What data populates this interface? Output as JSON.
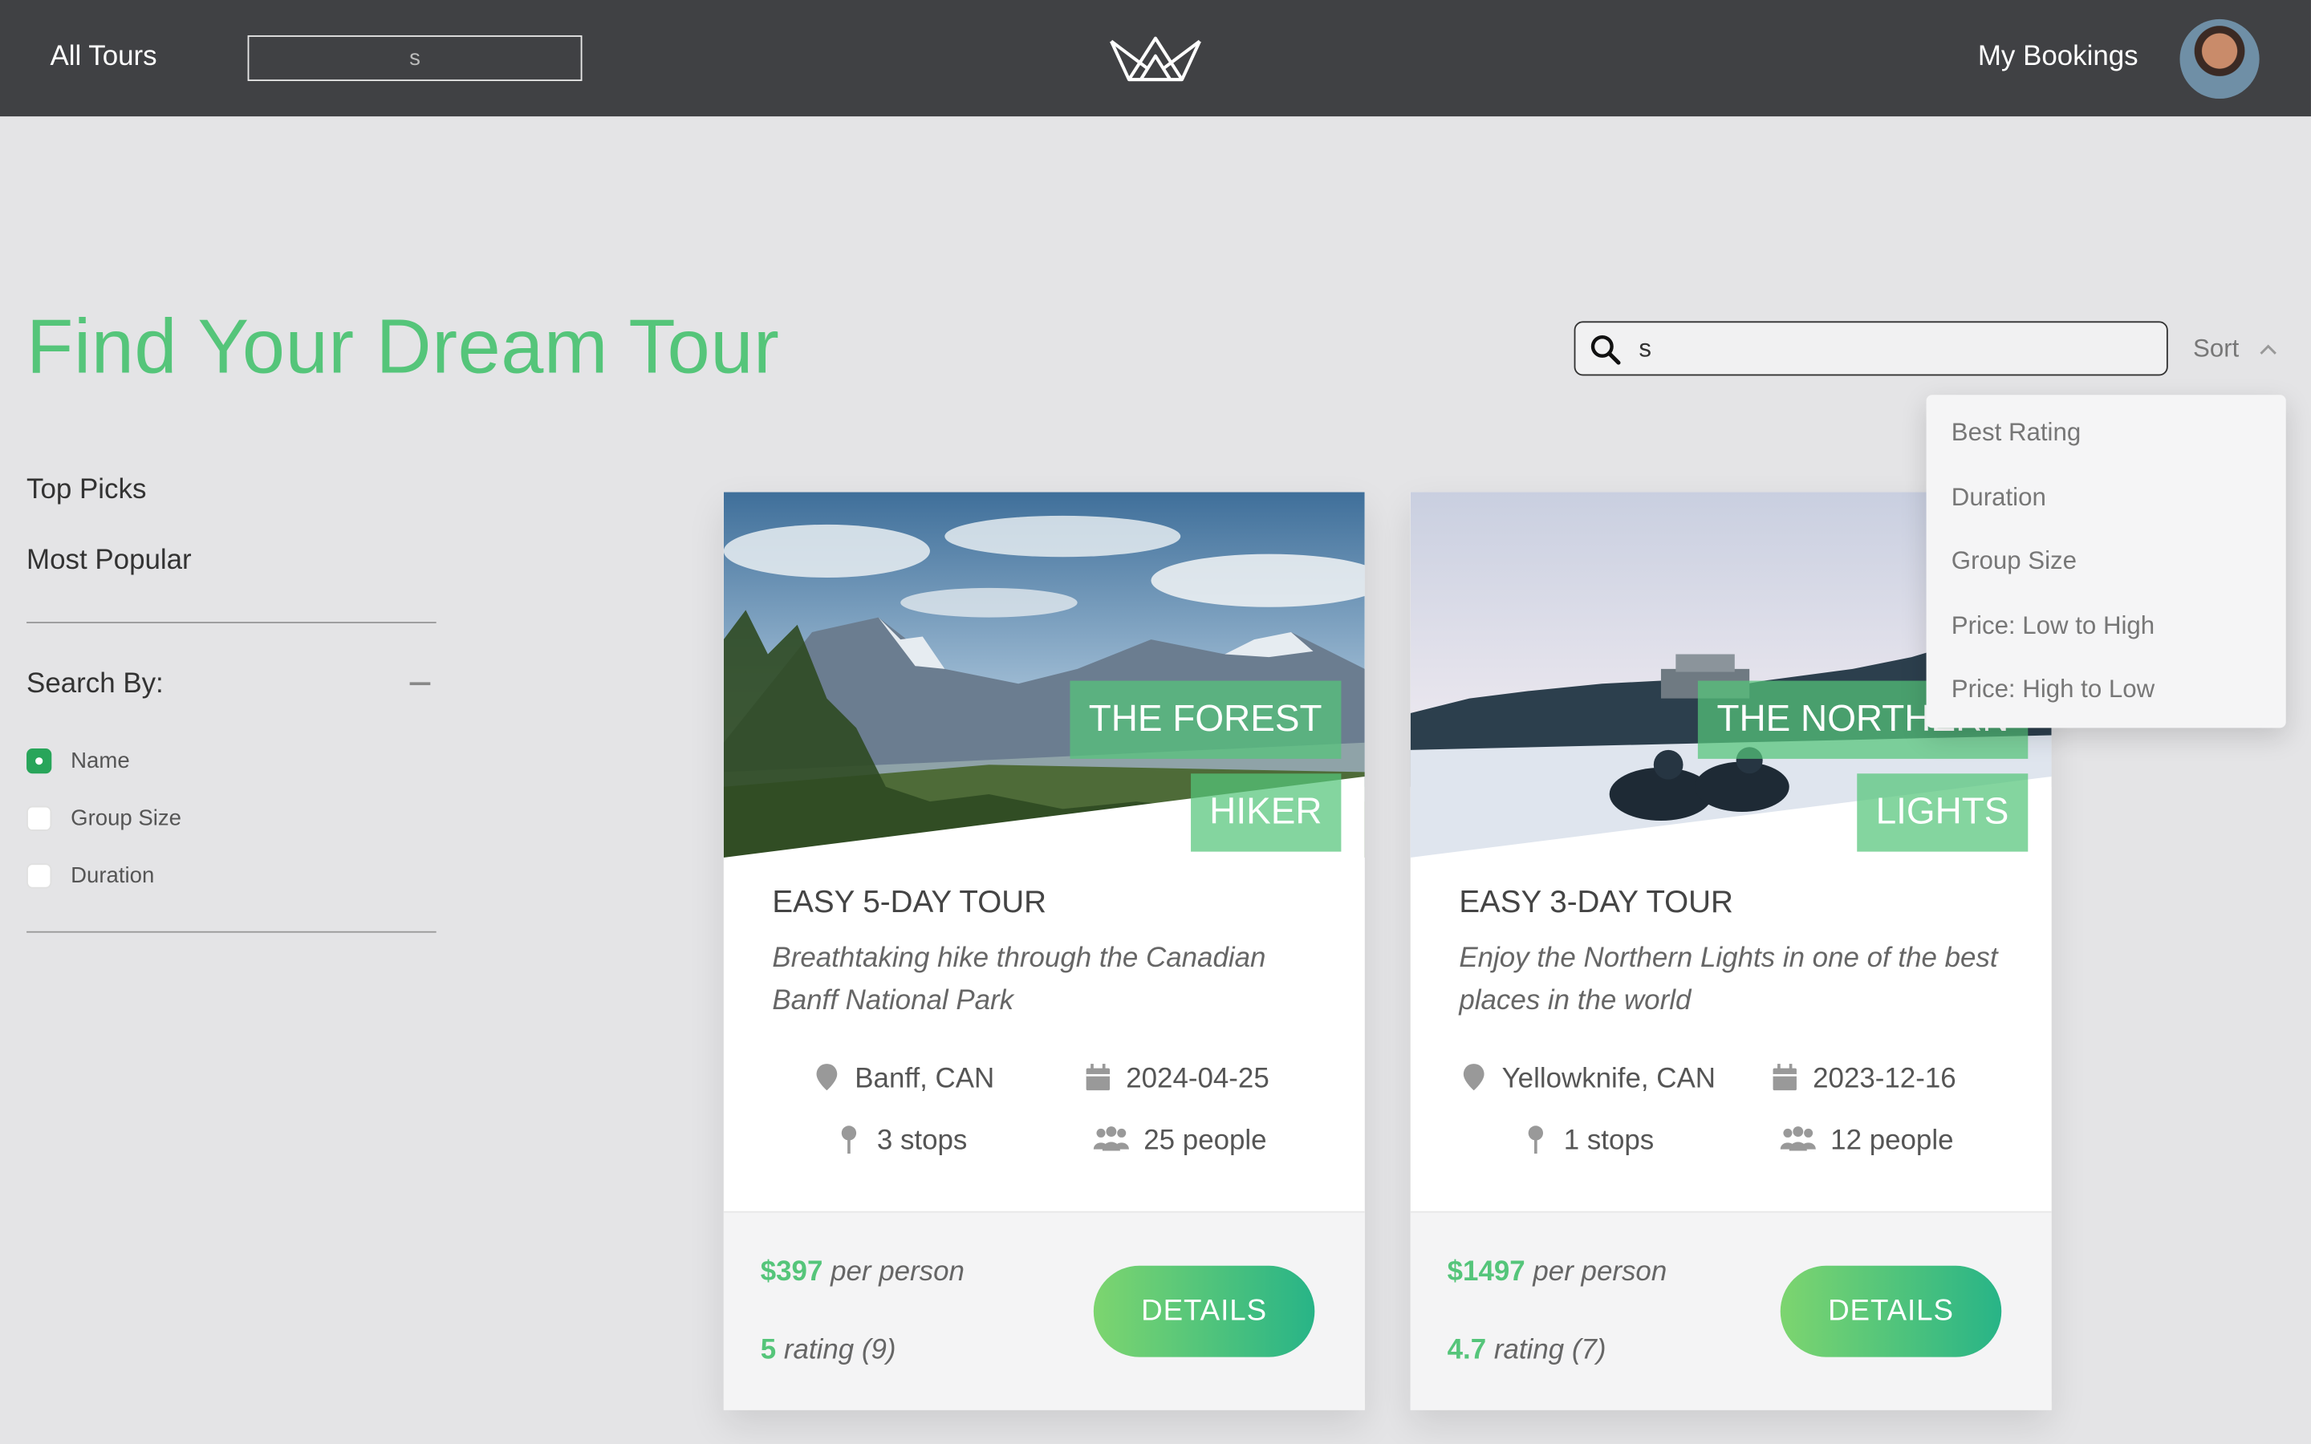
{
  "header": {
    "all_tours": "All Tours",
    "search_value": "s",
    "my_bookings": "My Bookings"
  },
  "page_title": "Find Your Dream Tour",
  "search": {
    "value": "s"
  },
  "sort": {
    "label": "Sort",
    "options": [
      "Best Rating",
      "Duration",
      "Group Size",
      "Price: Low to High",
      "Price: High to Low"
    ]
  },
  "sidebar": {
    "links": [
      "Top Picks",
      "Most Popular"
    ],
    "search_by_label": "Search By:",
    "options": [
      {
        "label": "Name",
        "checked": true
      },
      {
        "label": "Group Size",
        "checked": false
      },
      {
        "label": "Duration",
        "checked": false
      }
    ]
  },
  "tours": [
    {
      "name_line1": "THE FOREST",
      "name_line2": "HIKER",
      "title": "EASY 5-DAY TOUR",
      "description": "Breathtaking hike through the Canadian Banff National Park",
      "location": "Banff, CAN",
      "date": "2024-04-25",
      "stops": "3 stops",
      "people": "25 people",
      "price": "$397",
      "price_suffix": "per person",
      "rating": "5",
      "rating_suffix": "rating (9)",
      "button": "DETAILS"
    },
    {
      "name_line1": "THE NORTHERN",
      "name_line2": "LIGHTS",
      "title": "EASY 3-DAY TOUR",
      "description": "Enjoy the Northern Lights in one of the best places in the world",
      "location": "Yellowknife, CAN",
      "date": "2023-12-16",
      "stops": "1 stops",
      "people": "12 people",
      "price": "$1497",
      "price_suffix": "per person",
      "rating": "4.7",
      "rating_suffix": "rating (7)",
      "button": "DETAILS"
    }
  ],
  "colors": {
    "accent": "#55c57a",
    "topbar": "#404144",
    "background": "#e4e4e6"
  }
}
